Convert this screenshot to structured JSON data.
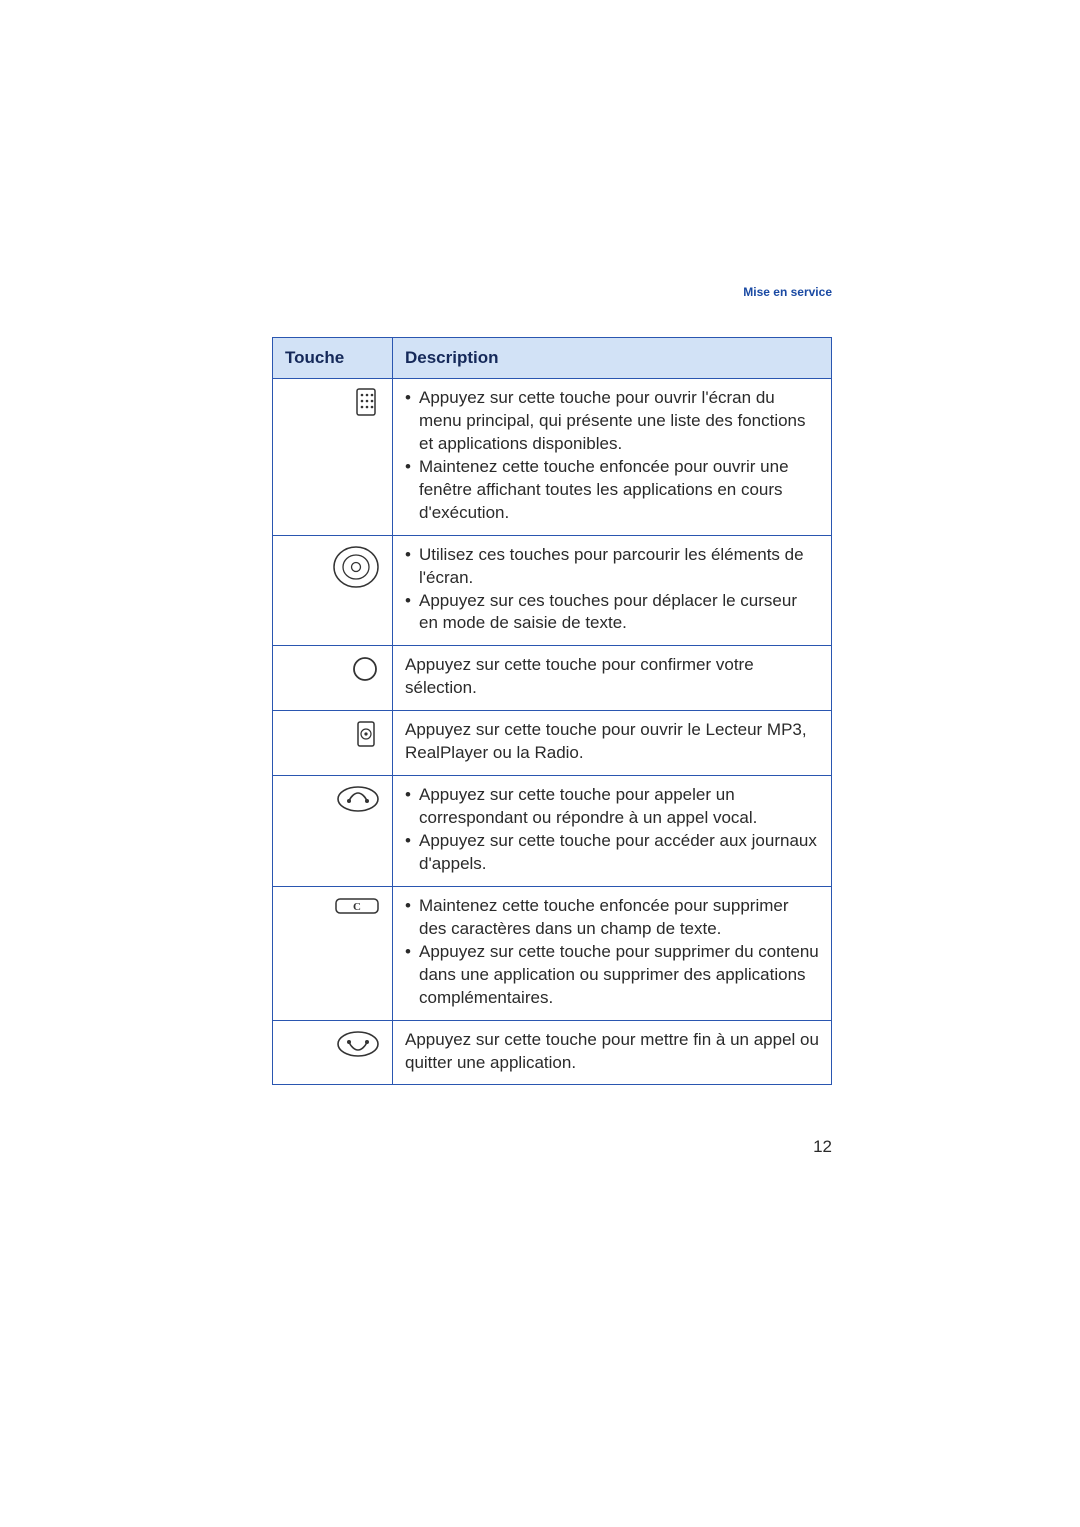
{
  "header": {
    "section_title": "Mise en service"
  },
  "table": {
    "col_key": "Touche",
    "col_desc": "Description",
    "rows": [
      {
        "icon": "menu-key-icon",
        "bullets": [
          "Appuyez sur cette touche pour ouvrir l'écran du menu principal, qui présente une liste des fonctions et applications disponibles.",
          "Maintenez cette touche enfoncée pour ouvrir une fenêtre affichant toutes les applications en cours d'exécution."
        ]
      },
      {
        "icon": "nav-ring-icon",
        "bullets": [
          "Utilisez ces touches pour parcourir les éléments de l'écran.",
          "Appuyez sur ces touches pour déplacer le curseur en mode de saisie de texte."
        ]
      },
      {
        "icon": "confirm-circle-icon",
        "text": "Appuyez sur cette touche pour confirmer votre sélection."
      },
      {
        "icon": "media-key-icon",
        "text": "Appuyez sur cette touche pour ouvrir le Lecteur MP3, RealPlayer ou la Radio."
      },
      {
        "icon": "call-key-icon",
        "bullets": [
          "Appuyez sur cette touche pour appeler un correspondant ou répondre à un appel vocal.",
          "Appuyez sur cette touche pour accéder aux journaux d'appels."
        ]
      },
      {
        "icon": "clear-key-icon",
        "bullets": [
          "Maintenez cette touche enfoncée pour supprimer des caractères dans un champ de texte.",
          "Appuyez sur cette touche pour supprimer du contenu dans une application ou supprimer des applications complémentaires."
        ]
      },
      {
        "icon": "end-key-icon",
        "text": "Appuyez sur cette touche pour mettre fin à un appel ou quitter une application."
      }
    ]
  },
  "page_number": "12"
}
